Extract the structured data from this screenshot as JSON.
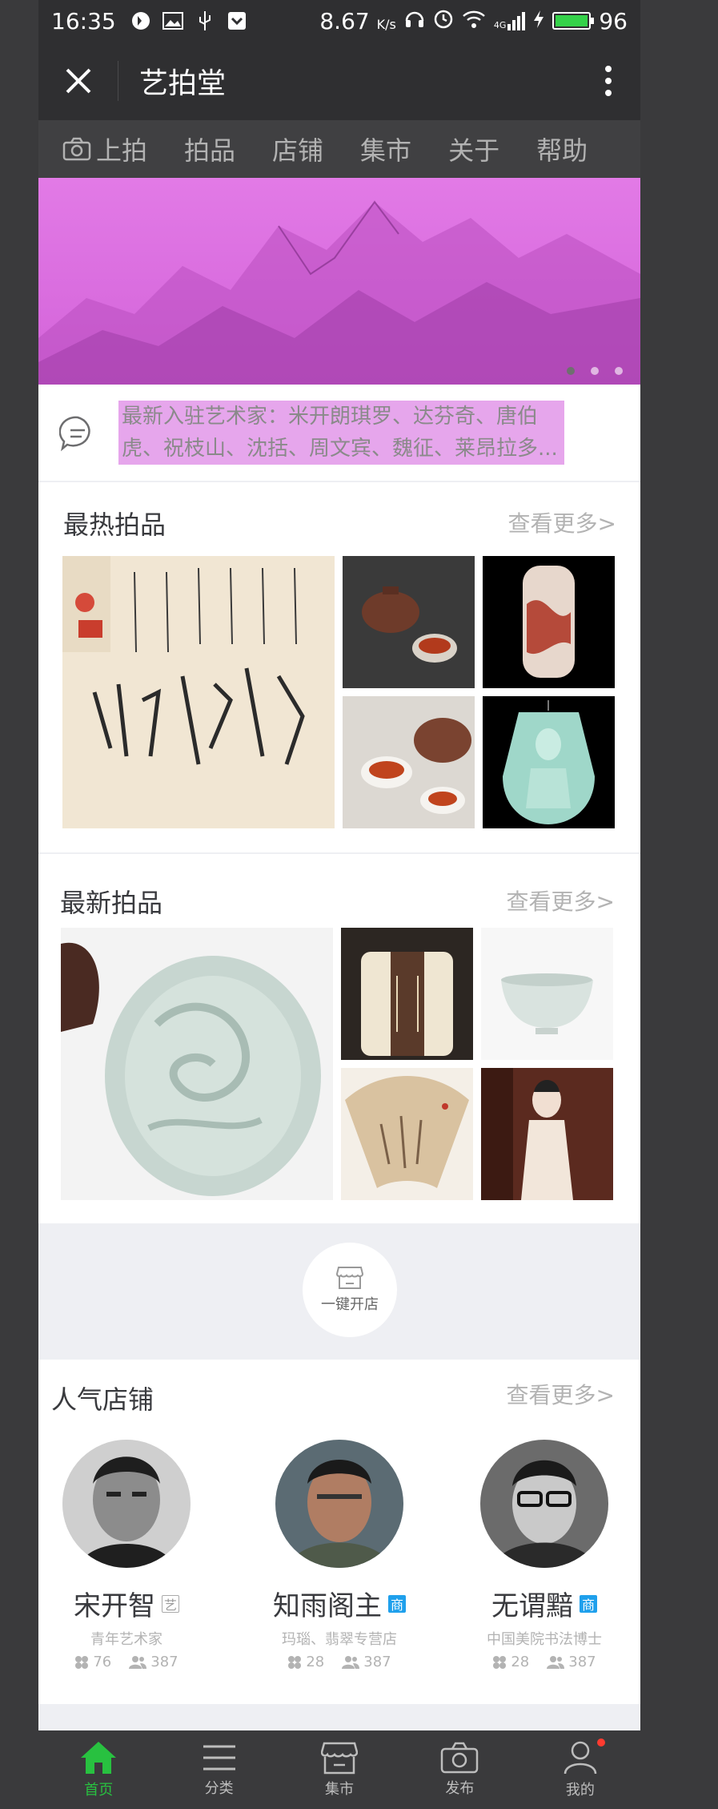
{
  "status_bar": {
    "time": "16:35",
    "speed": "8.67",
    "speed_unit": "K/s",
    "network": "4G",
    "battery": "96"
  },
  "header": {
    "title": "艺拍堂"
  },
  "nav": {
    "items": [
      {
        "label": "上拍",
        "icon": "camera-icon"
      },
      {
        "label": "拍品"
      },
      {
        "label": "店铺"
      },
      {
        "label": "集市"
      },
      {
        "label": "关于"
      },
      {
        "label": "帮助"
      }
    ]
  },
  "notice": {
    "text": "最新入驻艺术家：米开朗琪罗、达芬奇、唐伯虎、祝枝山、沈括、周文宾、魏征、莱昂拉多..."
  },
  "hot": {
    "title": "最热拍品",
    "more": "查看更多>"
  },
  "latest": {
    "title": "最新拍品",
    "more": "查看更多>"
  },
  "open_shop": {
    "label": "一键开店"
  },
  "shops": {
    "title": "人气店铺",
    "more": "查看更多>",
    "items": [
      {
        "name": "宋开智",
        "tag": "艺",
        "desc": "青年艺术家",
        "likes": "76",
        "fans": "387"
      },
      {
        "name": "知雨阁主",
        "tag": "商",
        "desc": "玛瑙、翡翠专营店",
        "likes": "28",
        "fans": "387"
      },
      {
        "name": "无谓黯",
        "tag": "商",
        "desc": "中国美院书法博士",
        "likes": "28",
        "fans": "387"
      }
    ]
  },
  "tabbar": {
    "items": [
      {
        "label": "首页",
        "icon": "home-icon"
      },
      {
        "label": "分类",
        "icon": "menu-icon"
      },
      {
        "label": "集市",
        "icon": "store-icon"
      },
      {
        "label": "发布",
        "icon": "camera-icon"
      },
      {
        "label": "我的",
        "icon": "user-icon"
      }
    ]
  },
  "colors": {
    "accent": "#28c140",
    "title_text": "#393a3e",
    "muted_text": "#b3b3b3",
    "divider": "#eeeff3",
    "biz_tag": "#1fa0ec"
  }
}
